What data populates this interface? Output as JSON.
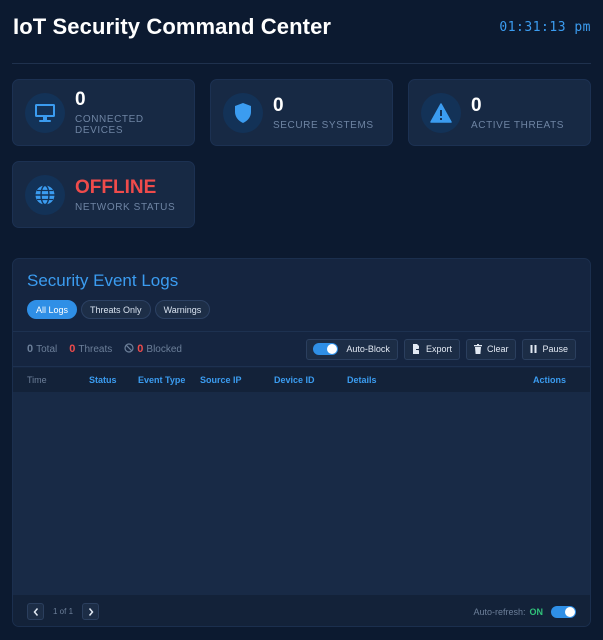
{
  "header": {
    "title": "IoT Security Command Center",
    "clock": "01:31:13 pm"
  },
  "stats": [
    {
      "value": "0",
      "label": "CONNECTED DEVICES",
      "icon": "monitor-icon"
    },
    {
      "value": "0",
      "label": "SECURE SYSTEMS",
      "icon": "shield-icon"
    },
    {
      "value": "0",
      "label": "ACTIVE THREATS",
      "icon": "warning-icon"
    },
    {
      "value": "OFFLINE",
      "label": "NETWORK STATUS",
      "icon": "globe-icon"
    }
  ],
  "logs": {
    "title": "Security Event Logs",
    "filters": [
      "All Logs",
      "Threats Only",
      "Warnings"
    ],
    "active_filter": "All Logs",
    "counts": {
      "total_value": "0",
      "total_label": "Total",
      "threats_value": "0",
      "threats_label": "Threats",
      "blocked_value": "0",
      "blocked_label": "Blocked"
    },
    "toolbar": {
      "autoblock_label": "Auto-Block",
      "autoblock_on": true,
      "export_label": "Export",
      "clear_label": "Clear",
      "pause_label": "Pause"
    },
    "columns": [
      "Time",
      "Status",
      "Event Type",
      "Source IP",
      "Device ID",
      "Details",
      "Actions"
    ],
    "rows": [],
    "pagination": {
      "info": "1 of 1"
    },
    "autorefresh": {
      "label": "Auto-refresh:",
      "state": "ON",
      "on": true
    }
  },
  "colors": {
    "background": "#0c1a30",
    "card": "#172944",
    "accent": "#3b9cf0",
    "danger": "#ef4b4b",
    "success": "#30c27a"
  }
}
